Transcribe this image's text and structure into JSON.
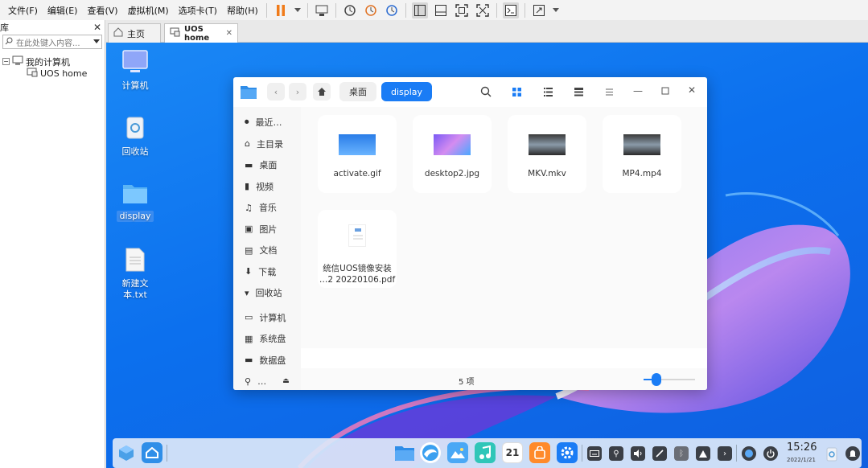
{
  "menubar": {
    "items": [
      "文件(F)",
      "编辑(E)",
      "查看(V)",
      "虚拟机(M)",
      "选项卡(T)",
      "帮助(H)"
    ]
  },
  "library": {
    "title": "库",
    "search_placeholder": "在此处键入内容...",
    "tree": {
      "root": "我的计算机",
      "child": "UOS home"
    }
  },
  "tabs": [
    {
      "label": "主页"
    },
    {
      "label": "UOS home"
    }
  ],
  "desktop_icons": [
    {
      "label": "计算机",
      "icon": "computer-icon"
    },
    {
      "label": "回收站",
      "icon": "trash-icon"
    },
    {
      "label": "display",
      "icon": "folder-icon"
    },
    {
      "label": "新建文\n本.txt",
      "icon": "text-file-icon"
    }
  ],
  "file_manager": {
    "breadcrumbs": [
      "桌面",
      "display"
    ],
    "sidebar": [
      "最近…",
      "主目录",
      "桌面",
      "视频",
      "音乐",
      "图片",
      "文档",
      "下载",
      "回收站",
      "计算机",
      "系统盘",
      "数据盘",
      "…"
    ],
    "files": [
      {
        "name": "activate.gif"
      },
      {
        "name": "desktop2.jpg"
      },
      {
        "name": "MKV.mkv"
      },
      {
        "name": "MP4.mp4"
      },
      {
        "name": "统信UOS镜像安装\n…2 20220106.pdf"
      }
    ],
    "status": "5 项",
    "zoom_level": 0.25
  },
  "dock": {
    "time": "15:26",
    "date": "2022/1/21",
    "calendar_day": "21"
  },
  "colors": {
    "accent": "#1a7cf5",
    "desktop": "#0c70ee"
  }
}
